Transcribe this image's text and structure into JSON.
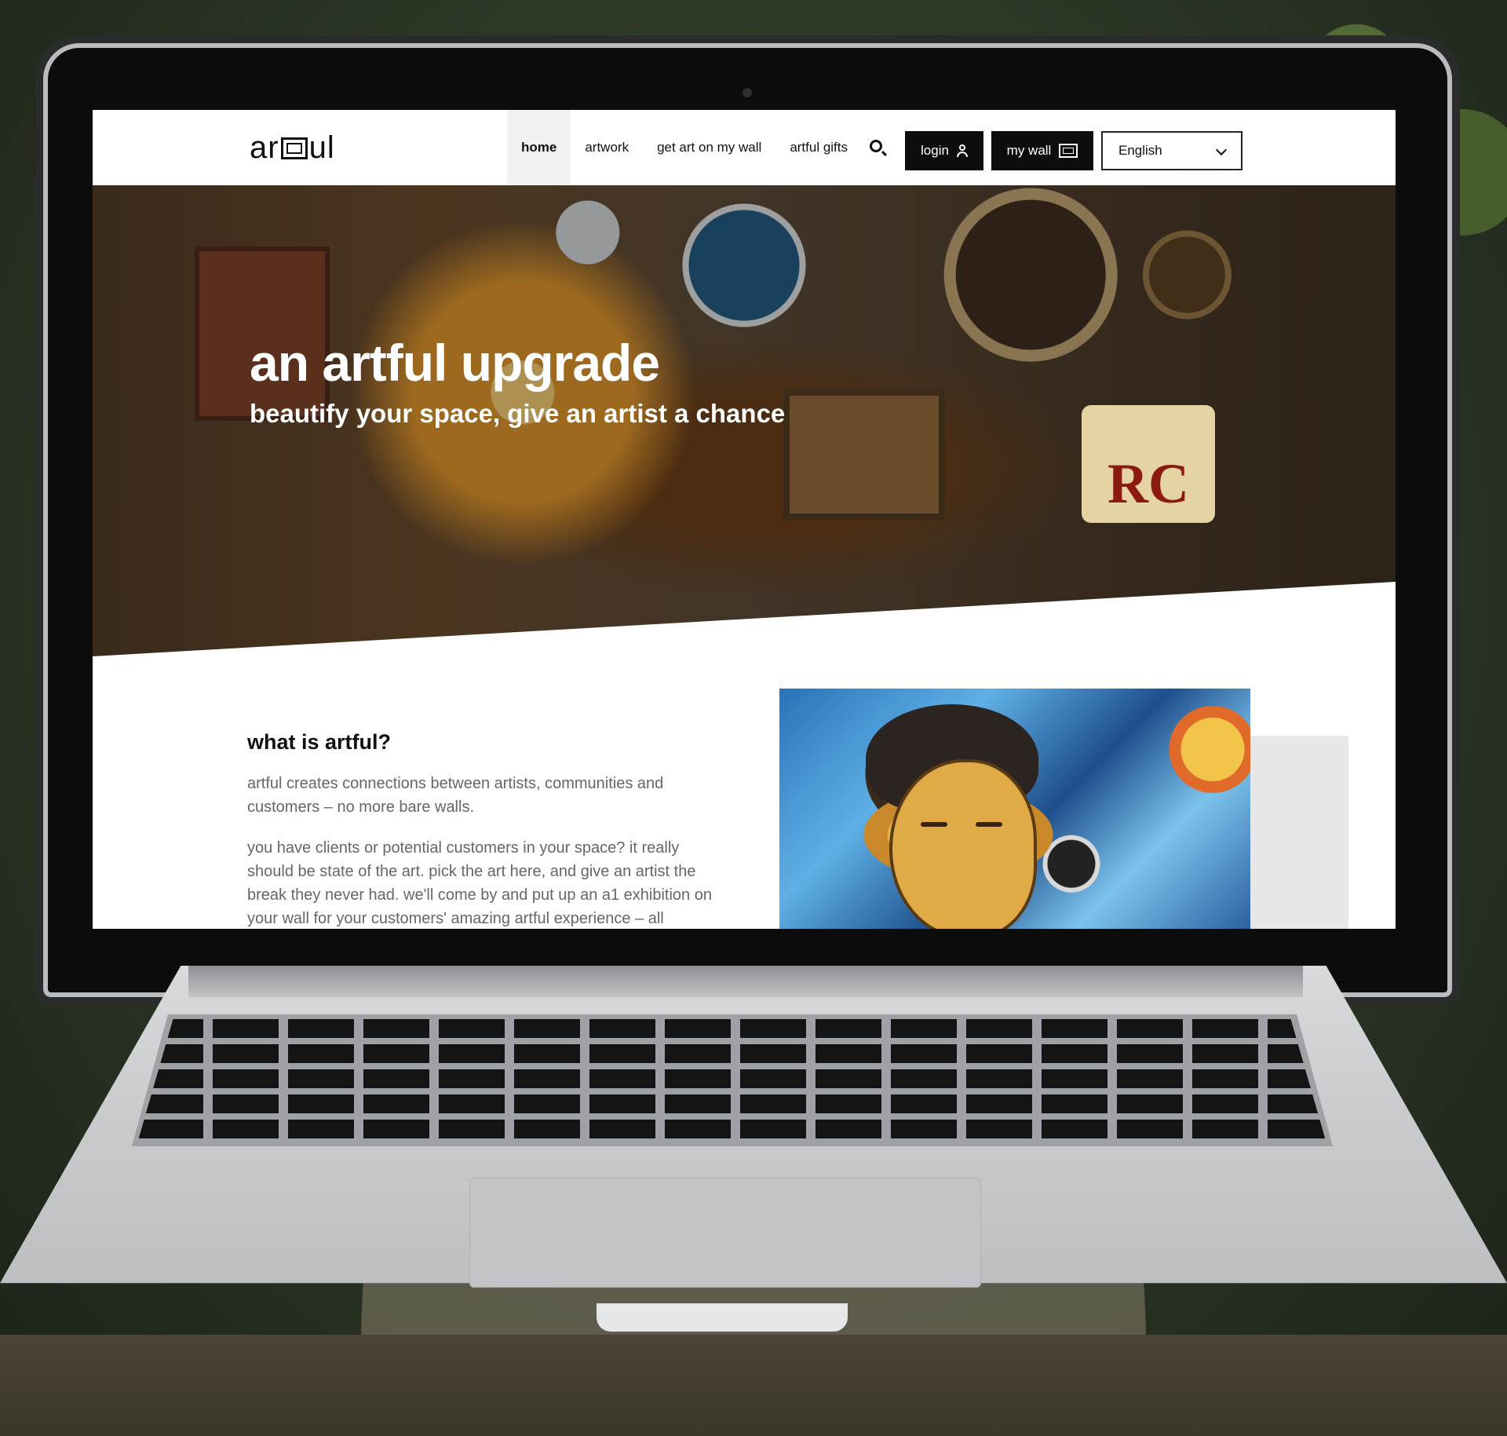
{
  "site": {
    "logo": "artful",
    "nav": {
      "items": [
        {
          "label": "home",
          "active": true
        },
        {
          "label": "artwork",
          "active": false
        },
        {
          "label": "get art on my wall",
          "active": false
        },
        {
          "label": "artful gifts",
          "active": false
        }
      ],
      "login_label": "login",
      "wall_label": "my wall",
      "language": "English"
    },
    "hero": {
      "title": "an artful upgrade",
      "subtitle": "beautify your space, give an artist a chance",
      "sign_text": "RC"
    },
    "about": {
      "heading": "what is artful?",
      "intro": "artful creates connections between artists, communities and customers – no more bare walls.",
      "body": "you have clients or potential customers in your space? it really should be state of the art. pick the art here, and give an artist the break they never had. we'll come by and put up an a1 exhibition on your wall for your customers' amazing artful experience – all artwork is"
    }
  },
  "icons": [
    "search-icon",
    "user-icon",
    "frame-icon",
    "chevron-down-icon"
  ],
  "colors": {
    "button_dark": "#0d0d0d",
    "text_gray": "#666666",
    "active_tab_bg": "#f1f1f1"
  }
}
